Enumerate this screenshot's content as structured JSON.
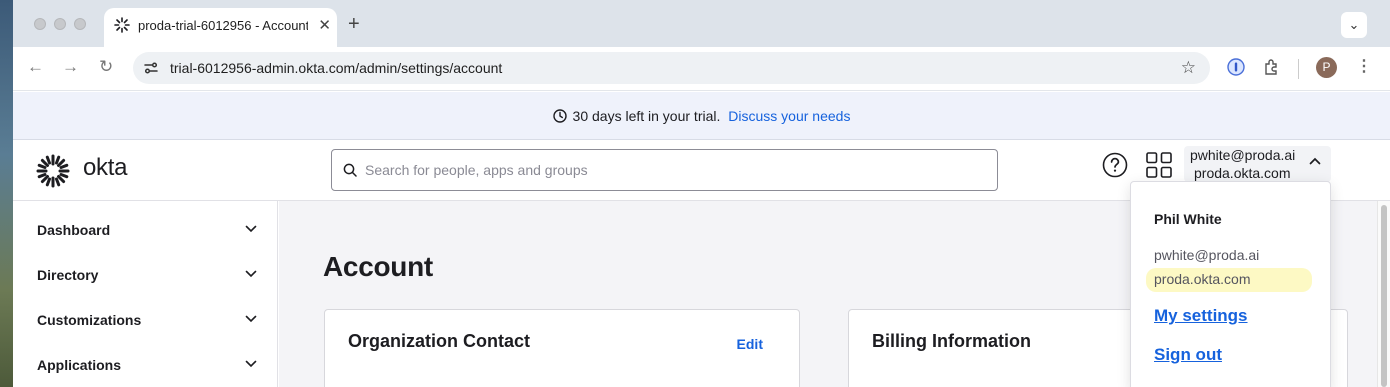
{
  "browser": {
    "tab_title": "proda-trial-6012956 - Account",
    "url": "trial-6012956-admin.okta.com/admin/settings/account",
    "profile_initial": "P"
  },
  "banner": {
    "text": "30 days left in your trial.",
    "link": "Discuss your needs"
  },
  "header": {
    "brand": "okta",
    "search_placeholder": "Search for people, apps and groups",
    "user_email": "pwhite@proda.ai",
    "user_org": "proda.okta.com"
  },
  "sidebar": {
    "items": [
      {
        "label": "Dashboard"
      },
      {
        "label": "Directory"
      },
      {
        "label": "Customizations"
      },
      {
        "label": "Applications"
      }
    ]
  },
  "main": {
    "title": "Account",
    "cards": [
      {
        "title": "Organization Contact",
        "action": "Edit"
      },
      {
        "title": "Billing Information"
      }
    ]
  },
  "user_menu": {
    "name": "Phil White",
    "email": "pwhite@proda.ai",
    "org": "proda.okta.com",
    "my_settings": "My settings",
    "sign_out": "Sign out"
  },
  "colors": {
    "link": "#1662dd",
    "banner_bg": "#eff2fb",
    "highlight": "#fdf9c4"
  }
}
